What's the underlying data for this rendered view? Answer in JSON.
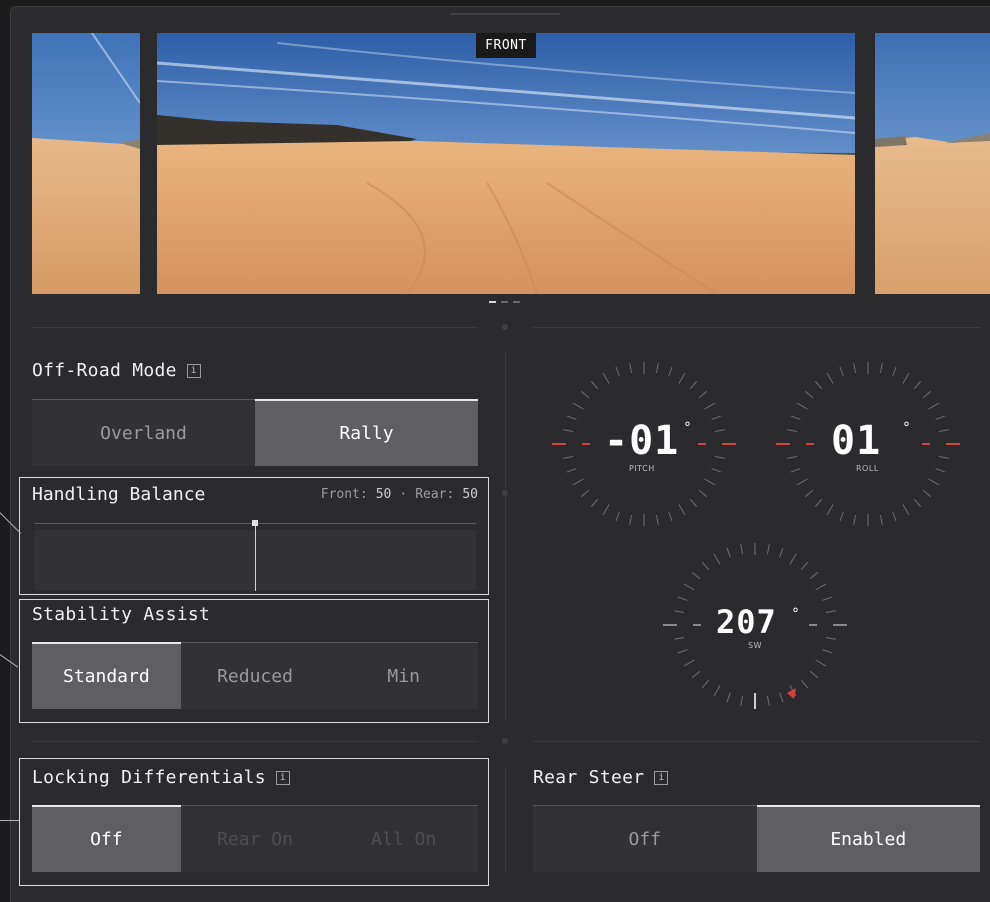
{
  "camera": {
    "label": "FRONT",
    "pages": 3,
    "active_page": 0
  },
  "offroad": {
    "title": "Off-Road Mode",
    "info_icon": "i",
    "options": [
      "Overland",
      "Rally"
    ],
    "selected": "Rally"
  },
  "handling": {
    "title": "Handling Balance",
    "front_label": "Front:",
    "front_value": "50",
    "separator": "·",
    "rear_label": "Rear:",
    "rear_value": "50",
    "balance": 0.5
  },
  "stability": {
    "title": "Stability Assist",
    "options": [
      "Standard",
      "Reduced",
      "Min"
    ],
    "selected": "Standard"
  },
  "locking": {
    "title": "Locking Differentials",
    "info_icon": "i",
    "options": [
      "Off",
      "Rear On",
      "All On"
    ],
    "selected": "Off"
  },
  "rear_steer": {
    "title": "Rear Steer",
    "info_icon": "i",
    "options": [
      "Off",
      "Enabled"
    ],
    "selected": "Enabled"
  },
  "gauges": {
    "pitch": {
      "value": "-01",
      "unit": "°",
      "label": "PITCH"
    },
    "roll": {
      "value": "01",
      "unit": "°",
      "label": "ROLL"
    },
    "heading": {
      "value": "207",
      "unit": "°",
      "label": "SW"
    }
  },
  "colors": {
    "accent_red": "#d9403a",
    "selected_bg": "#5f5f61",
    "panel_bg": "#2b2b2d"
  }
}
